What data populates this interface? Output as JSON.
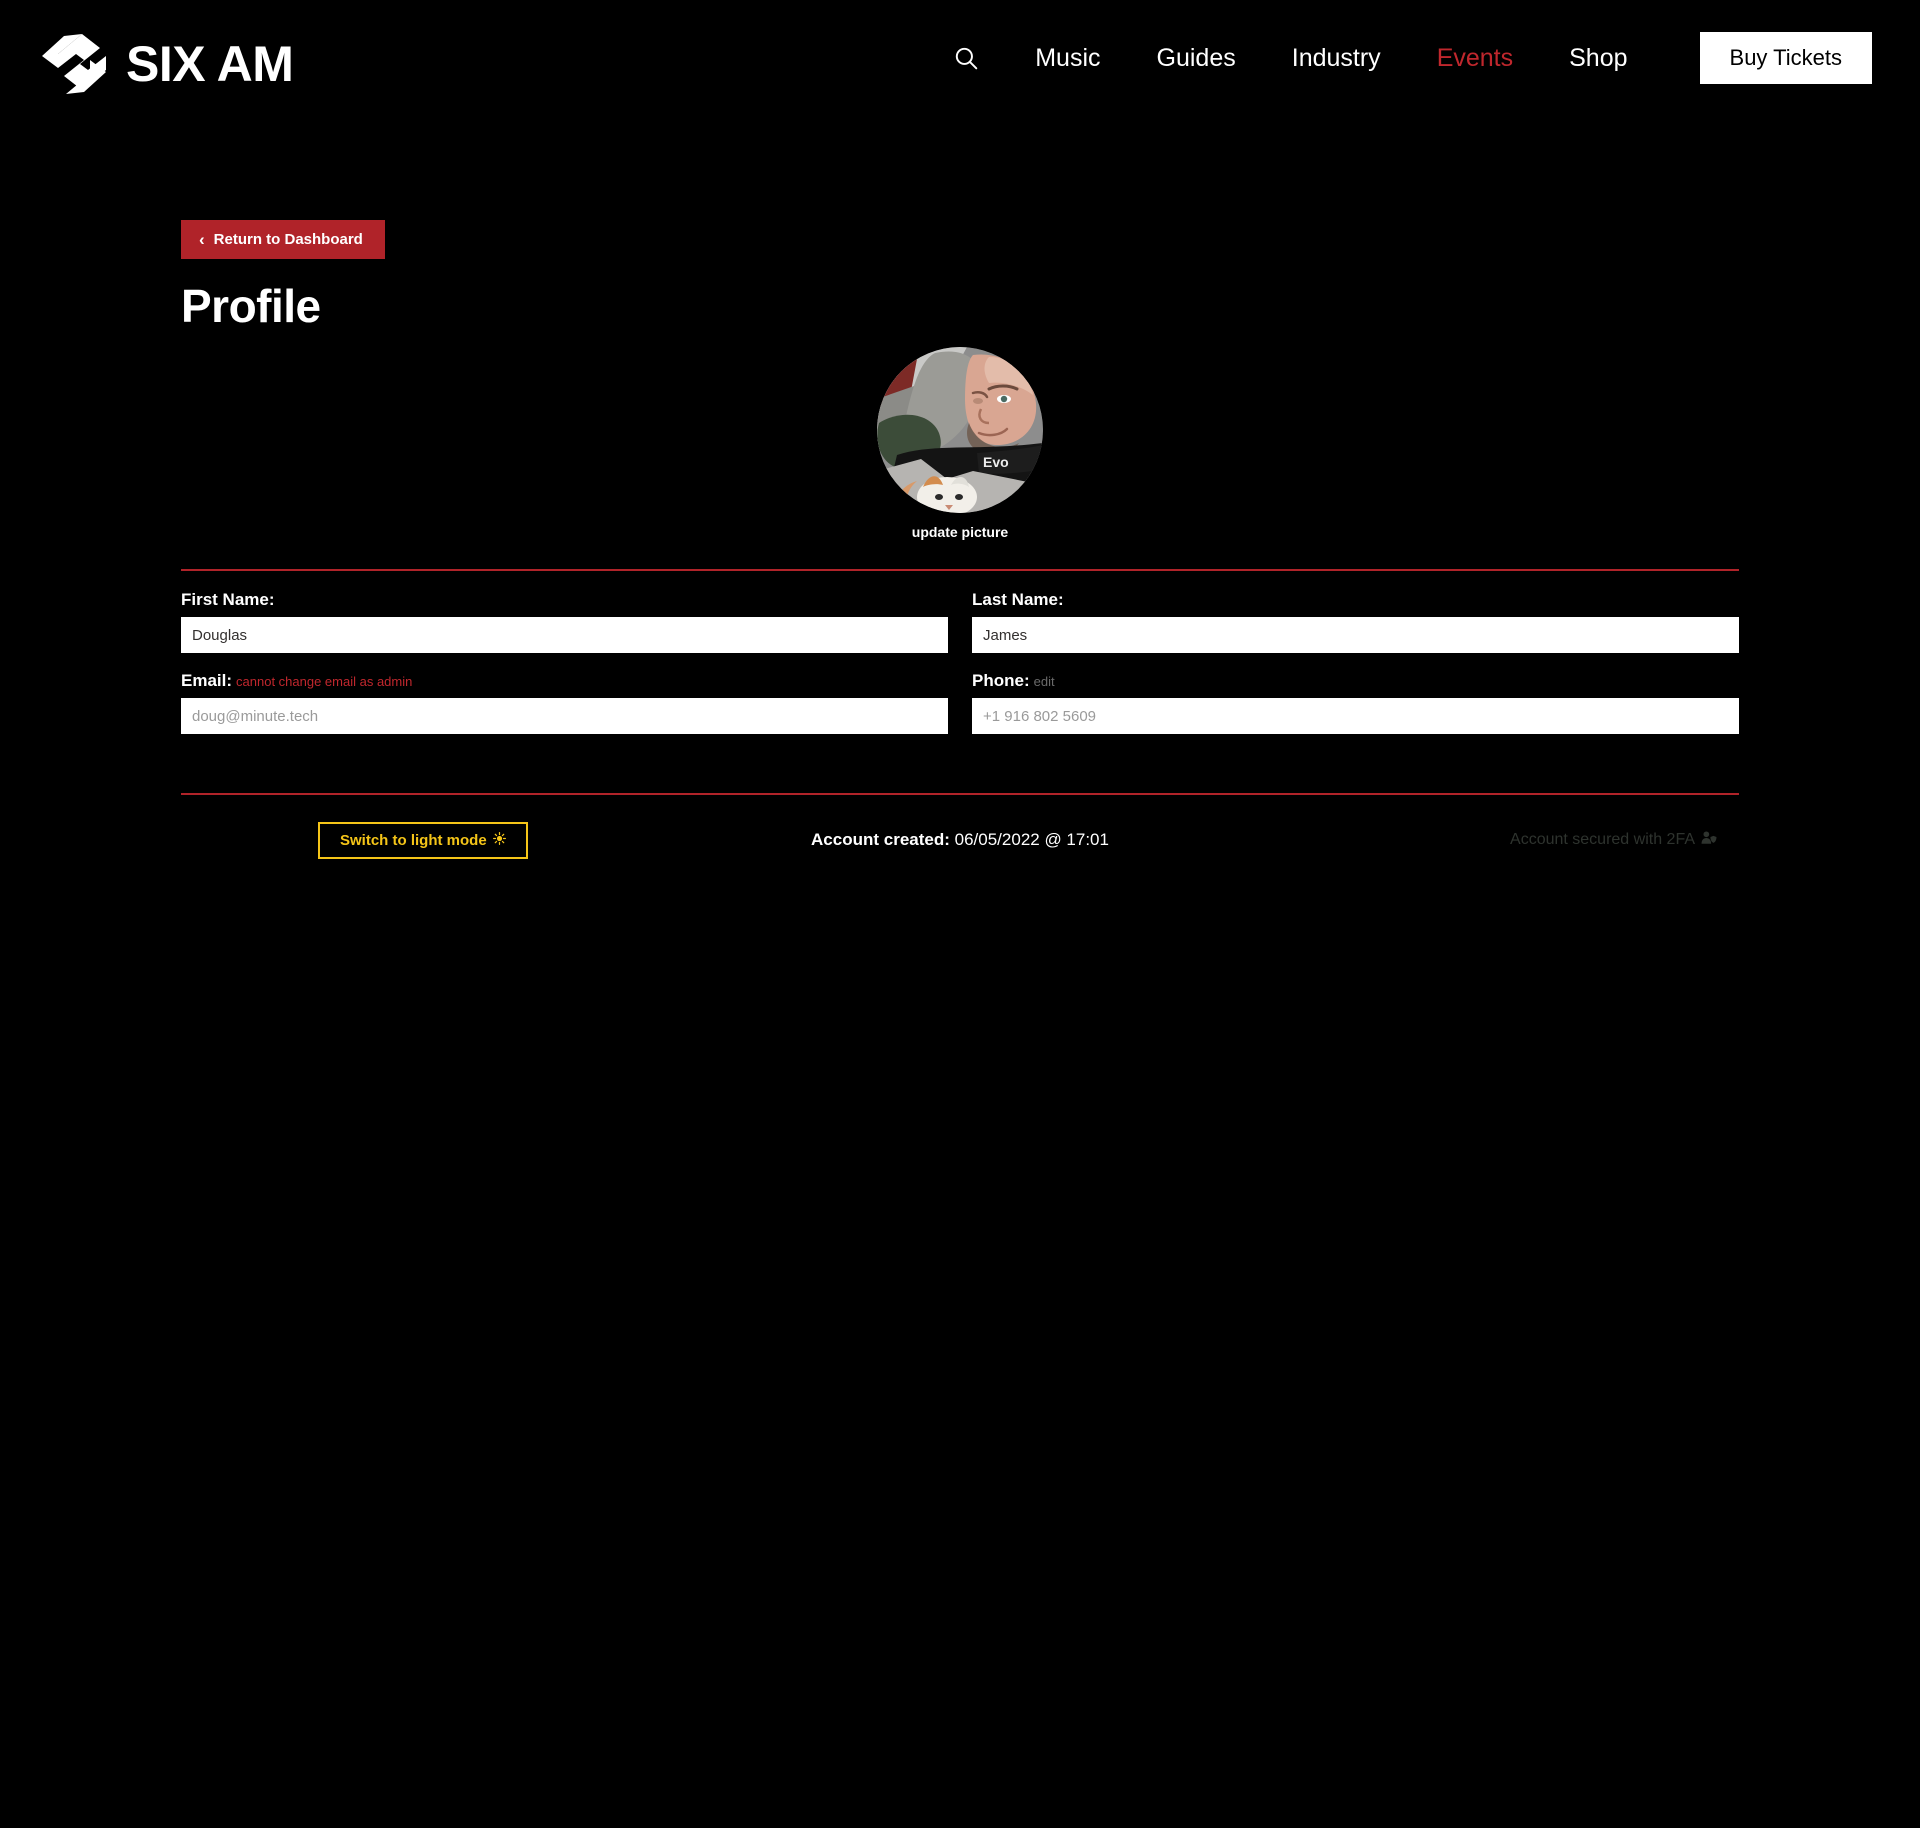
{
  "header": {
    "brand_word": "SIX AM",
    "brand_mark_icon": "sixam-logo-icon",
    "search_icon": "search-icon",
    "nav_items": [
      {
        "label": "Music",
        "active": false
      },
      {
        "label": "Guides",
        "active": false
      },
      {
        "label": "Industry",
        "active": false
      },
      {
        "label": "Events",
        "active": true
      },
      {
        "label": "Shop",
        "active": false
      }
    ],
    "buy_tickets_label": "Buy Tickets"
  },
  "page": {
    "return_button_label": "Return to Dashboard",
    "return_button_icon": "chevron-left-icon",
    "title": "Profile"
  },
  "avatar": {
    "caption": "update picture",
    "alt": "profile-photo"
  },
  "form": {
    "first_name": {
      "label": "First Name:",
      "value": "Douglas"
    },
    "last_name": {
      "label": "Last Name:",
      "value": "James"
    },
    "email": {
      "label": "Email:",
      "note": "cannot change email as admin",
      "value": "doug@minute.tech"
    },
    "phone": {
      "label": "Phone:",
      "note": "edit",
      "value": "+1 916 802 5609"
    }
  },
  "footer": {
    "light_mode_label": "Switch to light mode",
    "light_mode_icon": "sun-icon",
    "account_created_label": "Account created:",
    "account_created_value": "06/05/2022 @ 17:01",
    "twofa_label": "Account secured with 2FA",
    "twofa_icon": "user-shield-icon"
  },
  "colors": {
    "background": "#000000",
    "accent_red": "#b02329",
    "nav_active_red": "#c0272d",
    "light_mode_yellow": "#f5c518",
    "twofa_gray": "#2e332e"
  }
}
